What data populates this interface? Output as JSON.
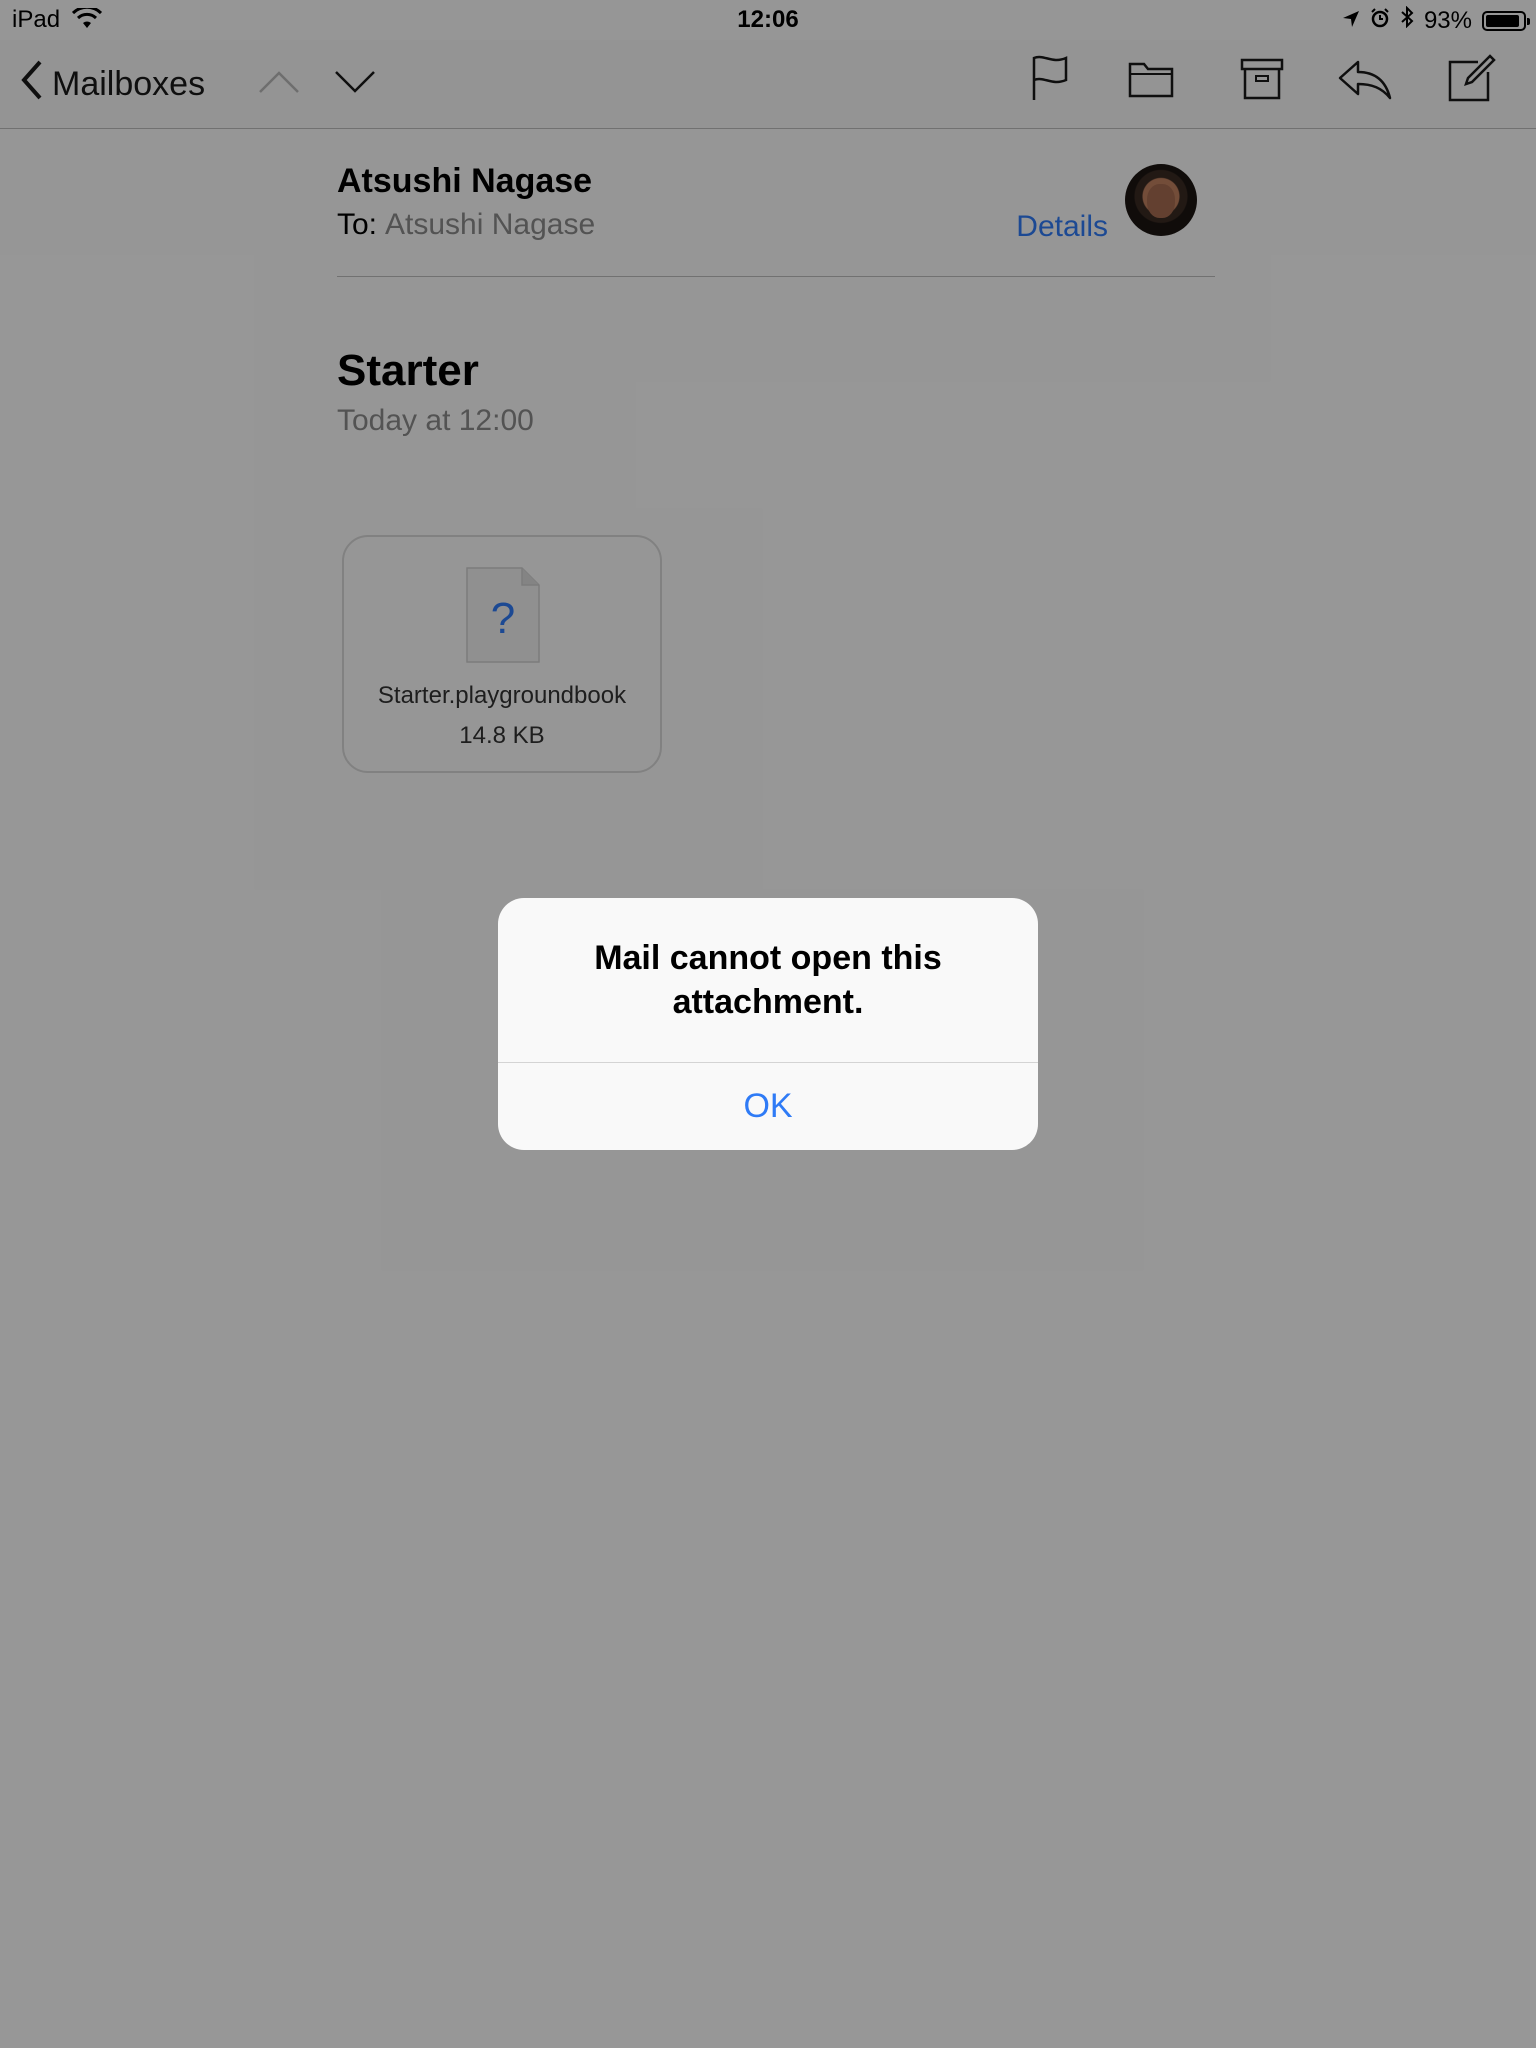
{
  "status_bar": {
    "carrier": "iPad",
    "time": "12:06",
    "battery_percent": "93%",
    "battery_level": 0.93
  },
  "nav": {
    "back_label": "Mailboxes",
    "icons": [
      "chevron-left-icon",
      "arrow-up-icon",
      "arrow-down-icon",
      "flag-icon",
      "folder-icon",
      "archive-icon",
      "reply-icon",
      "compose-icon"
    ]
  },
  "mail": {
    "sender": "Atsushi Nagase",
    "to_label": "To:",
    "to_name": "Atsushi Nagase",
    "details_label": "Details",
    "subject": "Starter",
    "date": "Today at 12:00"
  },
  "attachment": {
    "filename": "Starter.playgroundbook",
    "size": "14.8 KB",
    "icon_glyph": "?"
  },
  "alert": {
    "title": "Mail cannot open this attachment.",
    "ok_label": "OK"
  },
  "colors": {
    "accent": "#2f7bf6",
    "overlay": "rgba(0,0,0,0.4)"
  }
}
